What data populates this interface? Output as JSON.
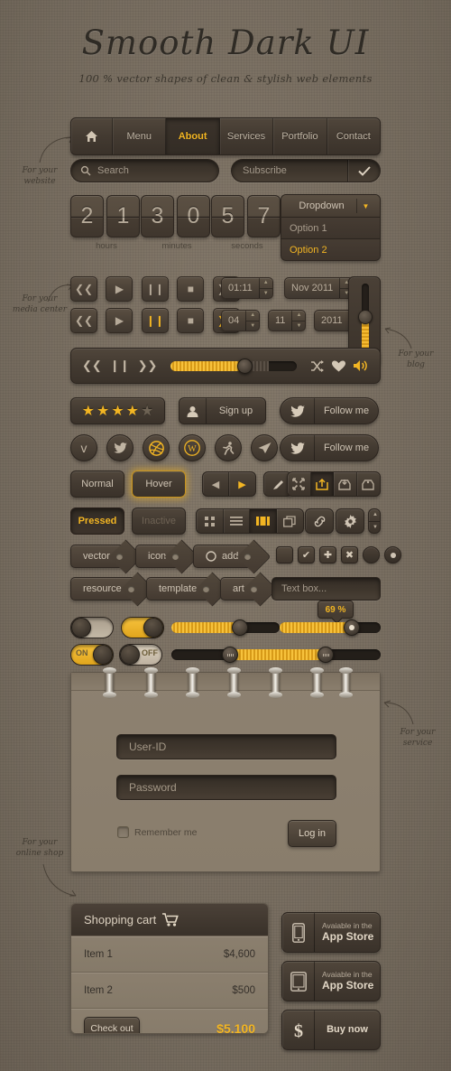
{
  "header": {
    "title": "Smooth Dark UI",
    "subtitle": "100 % vector shapes of clean & stylish web elements"
  },
  "annotations": [
    {
      "id": "website",
      "line1": "For your",
      "line2": "website"
    },
    {
      "id": "media",
      "line1": "For your",
      "line2": "media center"
    },
    {
      "id": "blog",
      "line1": "For your",
      "line2": "blog"
    },
    {
      "id": "service",
      "line1": "For your",
      "line2": "service"
    },
    {
      "id": "shop",
      "line1": "For your",
      "line2": "online shop"
    }
  ],
  "nav": {
    "home_icon": "home-icon",
    "items": [
      {
        "label": "Menu",
        "active": false
      },
      {
        "label": "About",
        "active": true
      },
      {
        "label": "Services",
        "active": false
      },
      {
        "label": "Portfolio",
        "active": false
      },
      {
        "label": "Contact",
        "active": false
      }
    ]
  },
  "search": {
    "placeholder": "Search",
    "icon": "search-icon"
  },
  "subscribe": {
    "placeholder": "Subscribe",
    "submit_icon": "check-icon"
  },
  "clock": {
    "groups": [
      {
        "digits": [
          "2",
          "1"
        ],
        "label": "hours"
      },
      {
        "digits": [
          "3",
          "0"
        ],
        "label": "minutes"
      },
      {
        "digits": [
          "5",
          "7"
        ],
        "label": "seconds"
      }
    ]
  },
  "dropdown": {
    "label": "Dropdown",
    "caret_icon": "chevron-down-icon",
    "options": [
      {
        "label": "Option 1",
        "selected": false
      },
      {
        "label": "Option 2",
        "selected": true
      }
    ]
  },
  "media_buttons": {
    "row1": [
      {
        "icon": "rewind-icon",
        "glyph": "«",
        "highlight": false
      },
      {
        "icon": "play-icon",
        "glyph": "▶",
        "highlight": false
      },
      {
        "icon": "pause-icon",
        "glyph": "▐▌",
        "highlight": false
      },
      {
        "icon": "stop-icon",
        "glyph": "■",
        "highlight": false
      },
      {
        "icon": "forward-icon",
        "glyph": "»",
        "highlight": false
      }
    ],
    "row2": [
      {
        "icon": "rewind-icon",
        "glyph": "«",
        "highlight": false
      },
      {
        "icon": "play-icon",
        "glyph": "▶",
        "highlight": false
      },
      {
        "icon": "pause-icon",
        "glyph": "▐▌",
        "highlight": true
      },
      {
        "icon": "stop-icon",
        "glyph": "■",
        "highlight": false
      },
      {
        "icon": "forward-icon",
        "glyph": "»",
        "highlight": true
      }
    ]
  },
  "spinners": {
    "row1": [
      {
        "value": "01:11"
      },
      {
        "value": "Nov 2011"
      }
    ],
    "row2": [
      {
        "value": "04"
      },
      {
        "value": "11"
      },
      {
        "value": "2011"
      }
    ],
    "up_glyph": "▲",
    "down_glyph": "▼"
  },
  "vertical_slider": {
    "fill_percent": 58
  },
  "player": {
    "prev_icon": "prev-icon",
    "pause_icon": "pause-icon",
    "next_icon": "next-icon",
    "shuffle_icon": "shuffle-icon",
    "heart_icon": "heart-icon",
    "volume_icon": "volume-icon",
    "progress_percent": 56,
    "buffer_percent": 22
  },
  "rating": {
    "filled": 4,
    "total": 5,
    "star_glyph": "★"
  },
  "signup": {
    "label": "Sign up",
    "icon": "user-icon"
  },
  "follow": [
    {
      "label": "Follow me",
      "icon": "twitter-bird-icon"
    },
    {
      "label": "Follow me",
      "icon": "twitter-bird-icon"
    }
  ],
  "social_icons": [
    {
      "name": "vimeo-icon",
      "glyph": "v",
      "gold": false
    },
    {
      "name": "twitter-icon",
      "glyph": "✆",
      "gold": false
    },
    {
      "name": "dribbble-icon",
      "glyph": "◎",
      "gold": true
    },
    {
      "name": "wordpress-icon",
      "glyph": "W",
      "gold": true
    },
    {
      "name": "runner-icon",
      "glyph": "↯",
      "gold": false
    },
    {
      "name": "send-icon",
      "glyph": "➤",
      "gold": false
    }
  ],
  "state_buttons": [
    {
      "label": "Normal",
      "state": "normal"
    },
    {
      "label": "Hover",
      "state": "hover"
    },
    {
      "label": "Pressed",
      "state": "pressed"
    },
    {
      "label": "Inactive",
      "state": "inactive"
    }
  ],
  "arrow_segment": [
    {
      "icon": "arrow-left-icon",
      "glyph": "◀",
      "gold": false
    },
    {
      "icon": "arrow-right-icon",
      "glyph": "▶",
      "gold": true
    }
  ],
  "pencil_button": {
    "icon": "pencil-icon",
    "glyph": "╱"
  },
  "tool_segment": [
    {
      "icon": "collapse-icon",
      "glyph": "⤢",
      "active": false
    },
    {
      "icon": "upload-icon",
      "glyph": "⬆",
      "active": true
    },
    {
      "icon": "inbox-in-icon",
      "glyph": "⬇",
      "active": false
    },
    {
      "icon": "inbox-out-icon",
      "glyph": "⬆",
      "active": false
    }
  ],
  "view_segment": [
    {
      "icon": "grid-view-icon",
      "glyph": "∷",
      "active": false
    },
    {
      "icon": "list-view-icon",
      "glyph": "≡",
      "active": false
    },
    {
      "icon": "gallery-view-icon",
      "glyph": "▐█▌",
      "active": true
    },
    {
      "icon": "window-view-icon",
      "glyph": "❐",
      "active": false
    }
  ],
  "link_button": {
    "icon": "link-icon",
    "glyph": "⚭"
  },
  "gear_button": {
    "icon": "gear-icon",
    "glyph": "⚙"
  },
  "mini_stepper": {
    "up_glyph": "▲",
    "down_glyph": "▼"
  },
  "tags": [
    {
      "label": "vector",
      "prefix": ""
    },
    {
      "label": "icon",
      "prefix": ""
    },
    {
      "label": "add",
      "prefix": "⬠"
    },
    {
      "label": "resource",
      "prefix": ""
    },
    {
      "label": "template",
      "prefix": ""
    },
    {
      "label": "art",
      "prefix": ""
    }
  ],
  "controls": {
    "checkbox_empty": {
      "icon": "checkbox-empty-icon",
      "glyph": ""
    },
    "checkbox_check": {
      "icon": "checkbox-checked-icon",
      "glyph": "✔"
    },
    "checkbox_plus": {
      "icon": "plus-icon",
      "glyph": "✚"
    },
    "checkbox_cross": {
      "icon": "close-icon",
      "glyph": "✖"
    },
    "radio_empty": {
      "icon": "radio-empty-icon"
    },
    "radio_selected": {
      "icon": "radio-selected-icon"
    }
  },
  "textbox": {
    "placeholder": "Text box..."
  },
  "toggles": [
    {
      "state": "off",
      "label": ""
    },
    {
      "state": "on",
      "label": ""
    },
    {
      "state": "on",
      "label": "ON"
    },
    {
      "state": "off",
      "label": "OFF"
    }
  ],
  "sliders": [
    {
      "id": "slider-1",
      "value_percent": 62,
      "tooltip": null
    },
    {
      "id": "slider-2",
      "value_percent": 69,
      "tooltip": "69 %"
    },
    {
      "id": "range-slider",
      "low_percent": 28,
      "high_percent": 74,
      "tooltip": null
    }
  ],
  "login": {
    "userid_placeholder": "User-ID",
    "password_placeholder": "Password",
    "remember_label": "Remember me",
    "login_button": "Log in",
    "rings": 7
  },
  "cart": {
    "title": "Shopping cart",
    "icon": "shopping-cart-icon",
    "rows": [
      {
        "name": "Item 1",
        "price": "$4,600"
      },
      {
        "name": "Item 2",
        "price": "$500"
      }
    ],
    "checkout_label": "Check out",
    "total": "$5,100"
  },
  "store_badges": [
    {
      "icon": "iphone-icon",
      "line1": "Avaiable in the",
      "line2": "App Store"
    },
    {
      "icon": "ipad-icon",
      "line1": "Avaiable in the",
      "line2": "App Store"
    },
    {
      "icon": "dollar-icon",
      "label": "Buy now"
    }
  ],
  "colors": {
    "background": "#7d7264",
    "accent_gold": "#f2b523",
    "dark_panel": "#463c32",
    "paper": "#8b8070"
  }
}
